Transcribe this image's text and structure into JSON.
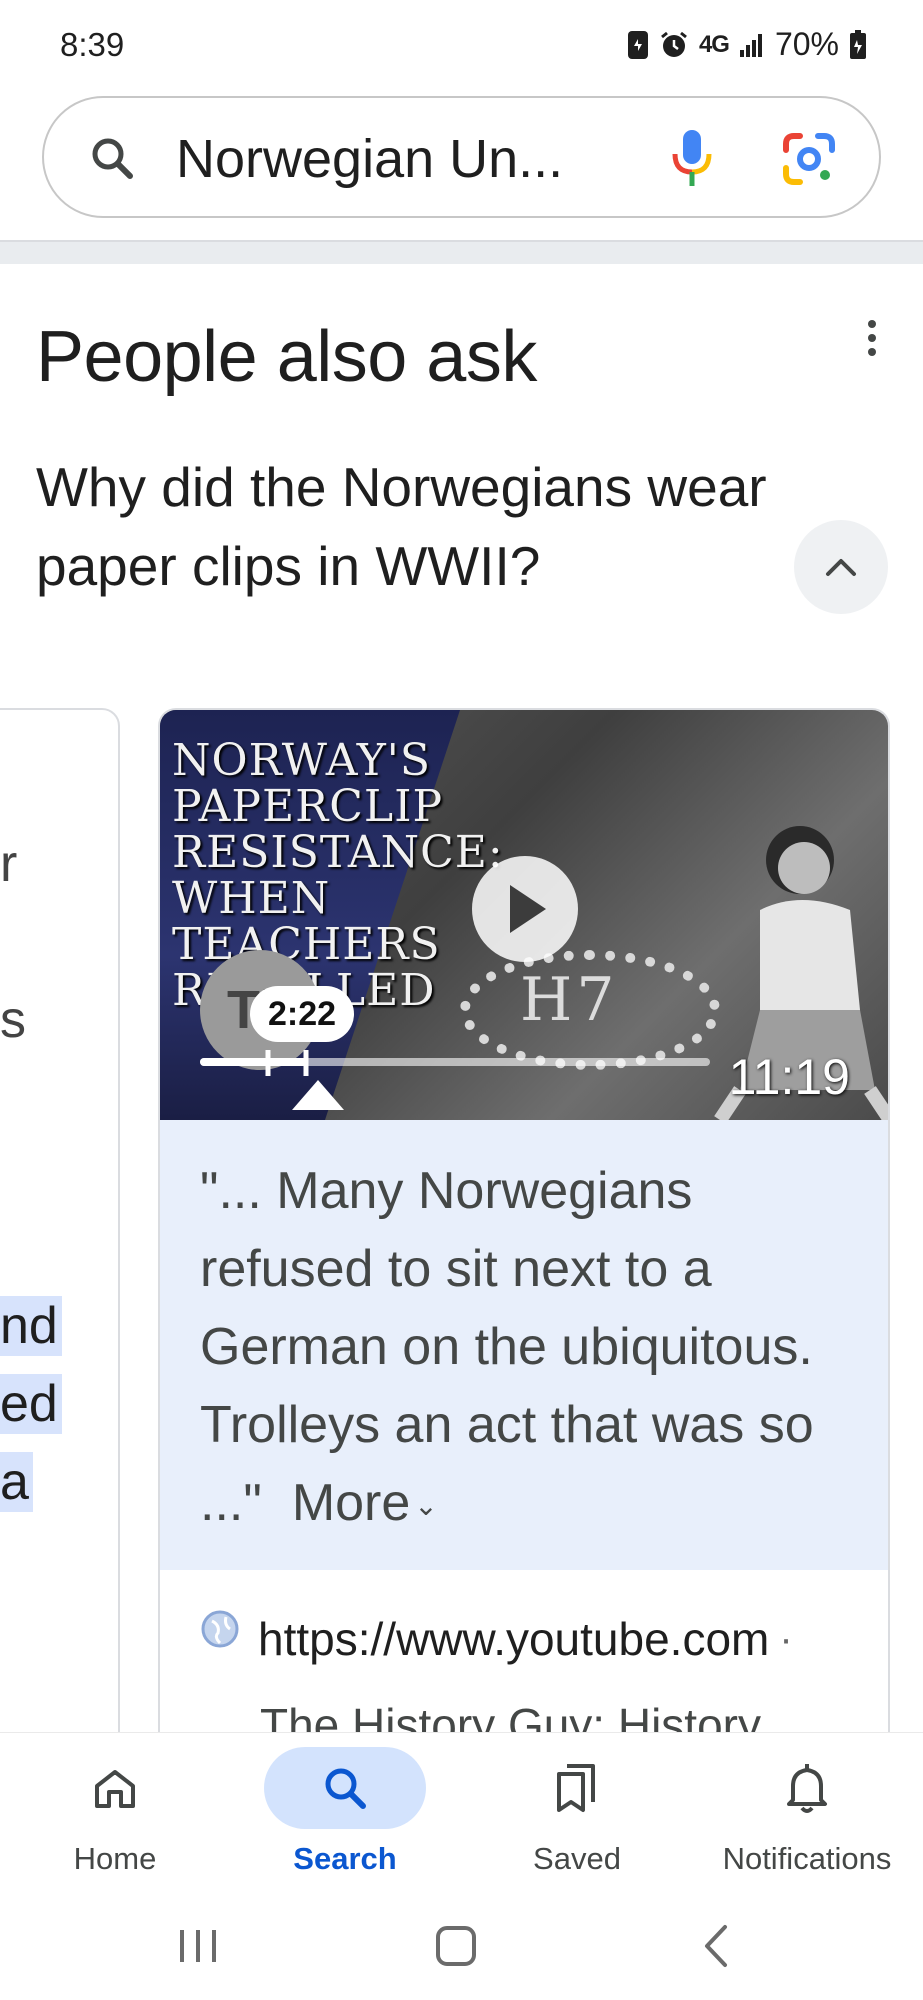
{
  "status_bar": {
    "time": "8:39",
    "network": "4G",
    "battery": "70%"
  },
  "search": {
    "query": "Norwegian Un...",
    "icons": [
      "search-icon",
      "mic-icon",
      "lens-icon"
    ]
  },
  "people_also_ask": {
    "title": "People also ask",
    "question": "Why did the Norwegians wear paper clips in WWII?",
    "left_card_fragments": [
      "r",
      "s",
      "nd",
      "ed",
      "a"
    ]
  },
  "video": {
    "thumbnail_title": "Norway's Paperclip Resistance: When Teachers Rebelled",
    "logo_text": "Th",
    "pebble_text": "H7",
    "seek_time": "2:22",
    "duration": "11:19",
    "progress": 0.21,
    "snippet": "\"... Many Norwegians refused to sit next to a German on the ubiquitous. Trolleys an act that was so ...\"",
    "more_label": "More",
    "source_url": "https://www.youtube.com",
    "source_separator": "·",
    "source_title": "The History Guy: History"
  },
  "bottom_nav": {
    "items": [
      {
        "label": "Home",
        "icon": "home-icon",
        "active": false
      },
      {
        "label": "Search",
        "icon": "search-icon",
        "active": true
      },
      {
        "label": "Saved",
        "icon": "bookmarks-icon",
        "active": false
      },
      {
        "label": "Notifications",
        "icon": "bell-icon",
        "active": false
      }
    ]
  },
  "colors": {
    "accent": "#0b57d0",
    "active_pill": "#d3e3fd",
    "snippet_bg": "#e8effb"
  }
}
